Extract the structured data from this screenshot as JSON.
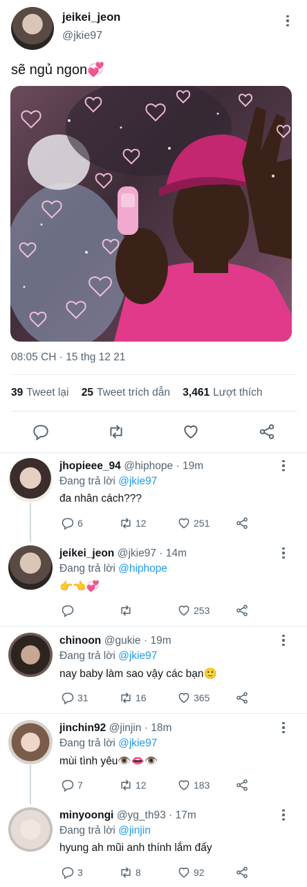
{
  "tweet": {
    "display_name": "jeikei_jeon",
    "handle": "@jkie97",
    "text": "sẽ ngủ ngon💞",
    "time": "08:05 CH · 15 thg 12 21",
    "stats": {
      "retweets_count": "39",
      "retweets_label": "Tweet lại",
      "quotes_count": "25",
      "quotes_label": "Tweet trích dẫn",
      "likes_count": "3,461",
      "likes_label": "Lượt thích"
    },
    "actions": [
      "reply-icon",
      "retweet-icon",
      "like-icon",
      "share-icon"
    ]
  },
  "replies": [
    {
      "display_name": "jhopieee_94",
      "handle": "@hiphope",
      "time": "· 19m",
      "replying_prefix": "Đang trả lời",
      "replying_to": "@jkie97",
      "text": "đa nhân cách???",
      "reply_count": "6",
      "retweet_count": "12",
      "like_count": "251"
    },
    {
      "display_name": "jeikei_jeon",
      "handle": "@jkie97",
      "time": "· 14m",
      "replying_prefix": "Đang trả lời",
      "replying_to": "@hiphope",
      "text": "👉👈💞",
      "reply_count": "",
      "retweet_count": "",
      "like_count": "253"
    },
    {
      "display_name": "chinoon",
      "handle": "@gukie",
      "time": "· 19m",
      "replying_prefix": "Đang trả lời",
      "replying_to": "@jkie97",
      "text": "nay baby làm sao vậy các bạn🙂",
      "reply_count": "31",
      "retweet_count": "16",
      "like_count": "365"
    },
    {
      "display_name": "jinchin92",
      "handle": "@jinjin",
      "time": "· 18m",
      "replying_prefix": "Đang trả lời",
      "replying_to": "@jkie97",
      "text": "mùi tình yêu👁️👄👁️",
      "reply_count": "7",
      "retweet_count": "12",
      "like_count": "183"
    },
    {
      "display_name": "minyoongi",
      "handle": "@yg_th93",
      "time": "· 17m",
      "replying_prefix": "Đang trả lời",
      "replying_to": "@jinjin",
      "text": "hyung ah mũi anh thính lắm đấy",
      "reply_count": "3",
      "retweet_count": "8",
      "like_count": "92"
    }
  ],
  "colors": {
    "accent": "#1d9bf0",
    "muted": "#536471",
    "text": "#0f1419",
    "divider": "#e6ecf0"
  }
}
